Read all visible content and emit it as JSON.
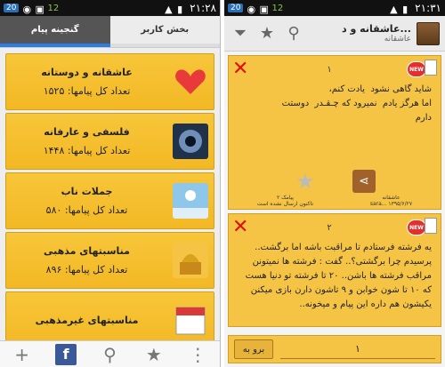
{
  "left": {
    "status": {
      "badge": "20",
      "signal": "12",
      "time": "۲۱:۲۸"
    },
    "tabs": {
      "sender": "بخش کاربر",
      "archive": "گنجینه پیام"
    },
    "cards": [
      {
        "title": "عاشقانه و دوستانه",
        "count_label": "تعداد کل پیامها:",
        "count": "۱۵۲۵",
        "icon": "heart-icon"
      },
      {
        "title": "فلسفی و عارفانه",
        "count_label": "تعداد کل پیامها:",
        "count": "۱۴۴۸",
        "icon": "eye-icon"
      },
      {
        "title": "جملات ناب",
        "count_label": "تعداد کل پیامها:",
        "count": "۵۸۰",
        "icon": "sky-icon"
      },
      {
        "title": "مناسبتهای مذهبی",
        "count_label": "تعداد کل پیامها:",
        "count": "۸۹۶",
        "icon": "shrine-icon"
      },
      {
        "title": "مناسبتهای غیرمذهبی",
        "count_label": "",
        "count": "",
        "icon": "calendar-icon"
      }
    ],
    "bottom": {
      "fb": "f"
    }
  },
  "right": {
    "status": {
      "badge": "20",
      "signal": "12",
      "time": "۲۱:۳۱"
    },
    "header": {
      "title": "عاشقانه و د...",
      "subtitle": "عاشقانه"
    },
    "messages": [
      {
        "num": "۱",
        "new": "NEW",
        "text": "شاید گاهی نشود  یادت کنم،\nاما هرگز یادم  نمیرود که چـقـدر  دوستت\nدارم",
        "category": "عاشقانه",
        "date": "sara... ۱۳۹۵/۶/۲۷",
        "sent_label": "۲ پیامک",
        "sent_note": "تاکنون ارسال نشده است"
      },
      {
        "num": "۲",
        "new": "NEW",
        "text": "یه فرشته فرستادم تا مراقبت باشه اما برگشت..\nپرسیدم چرا برگشتی؟.. گفت : فرشته ها نمیتونن\nمراقب فرشته ها باشن.. ۲۰ تا فرشته تو دنیا هست\nکه ۱۰ تا شون خوابن و ۹ تاشون دارن بازی میکنن\nیکیشون هم داره این پیام و میخونه.."
      }
    ],
    "pager": {
      "goto": "برو به",
      "page": "۱"
    }
  }
}
